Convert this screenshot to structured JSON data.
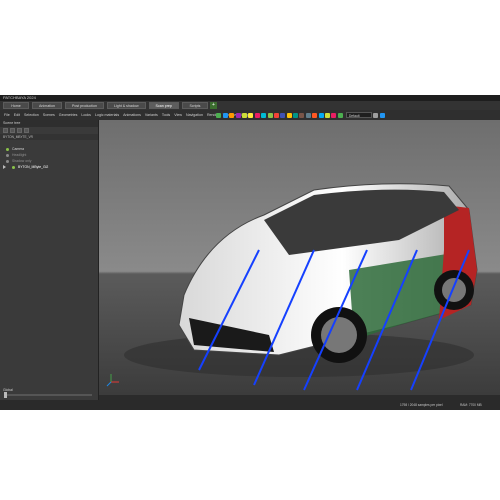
{
  "window": {
    "title": "PATCHBAYA 2024"
  },
  "tabs": [
    {
      "label": "Home"
    },
    {
      "label": "Animation"
    },
    {
      "label": "Post production"
    },
    {
      "label": "Light & shadow"
    },
    {
      "label": "Scan prep"
    },
    {
      "label": "Scripts"
    }
  ],
  "menu": [
    "File",
    "Edit",
    "Selection",
    "Scenes",
    "Geometries",
    "Looks",
    "Logic materials",
    "Animations",
    "Variants",
    "Tools",
    "View",
    "Navigation",
    "Render",
    "Windows",
    "Help"
  ],
  "toolbar": {
    "render_dropdown": "Interactive",
    "quality_dropdown": "Default renderer"
  },
  "sidebar": {
    "title": "Scene tree",
    "path": "BYTON_MBYTE_VR",
    "items": [
      {
        "label": "Camera"
      },
      {
        "label": "Headlight"
      },
      {
        "label": "Shadow only"
      },
      {
        "label": "BYTON_MByte_Gi2"
      }
    ],
    "bottom_label": "Global"
  },
  "status": {
    "left": "1798 / 2048 samples per pixel",
    "right": "RAM: 7700 MB"
  },
  "colors": {
    "line": "#1540ff",
    "green": "#2e6b3a",
    "red": "#b52424"
  }
}
